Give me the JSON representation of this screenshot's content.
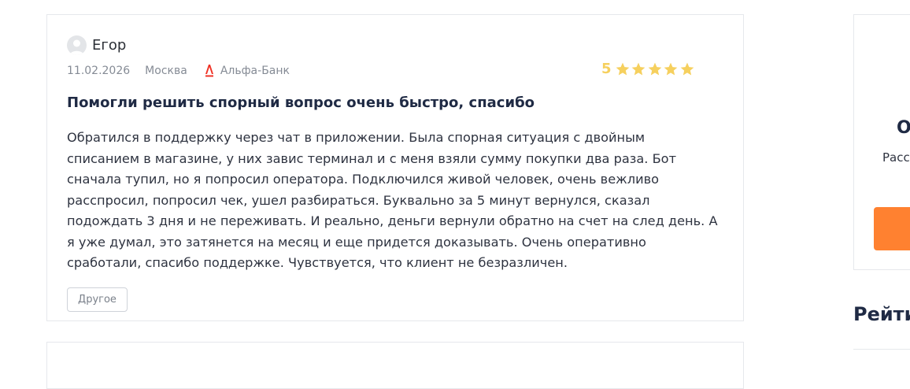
{
  "review": {
    "author": "Егор",
    "date": "11.02.2026",
    "city": "Москва",
    "bank": "Альфа-Банк",
    "rating": "5",
    "star_count": 5,
    "title": "Помогли решить спорный вопрос очень быстро, спасибо",
    "text": "Обратился в поддержку через чат в приложении. Была спорная ситуация с двойным списанием в магазине, у них завис терминал и с меня взяли сумму покупки два раза. Бот сначала тупил, но я попросил оператора. Подключился живой человек, очень вежливо расспросил, попросил чек, ушел разбираться. Буквально за 5 минут вернулся, сказал подождать 3 дня и не переживать. И реально, деньги вернули обратно на счет на след день. А я уже думал, это затянется на месяц и еще придется доказывать. Очень оперативно сработали, спасибо поддержке. Чувствуется, что клиент не безразличен.",
    "tag": "Другое"
  },
  "sidebar": {
    "card_heading": "О",
    "card_text": "Расс",
    "section_title": "Рейти"
  },
  "colors": {
    "star": "#f6d05e",
    "bank_logo": "#ef3124",
    "accent_button": "#ff8130",
    "title": "#1f2a44"
  },
  "icons": {
    "avatar": "user-avatar-icon",
    "bank": "alfa-bank-logo-icon",
    "star": "star-icon"
  }
}
